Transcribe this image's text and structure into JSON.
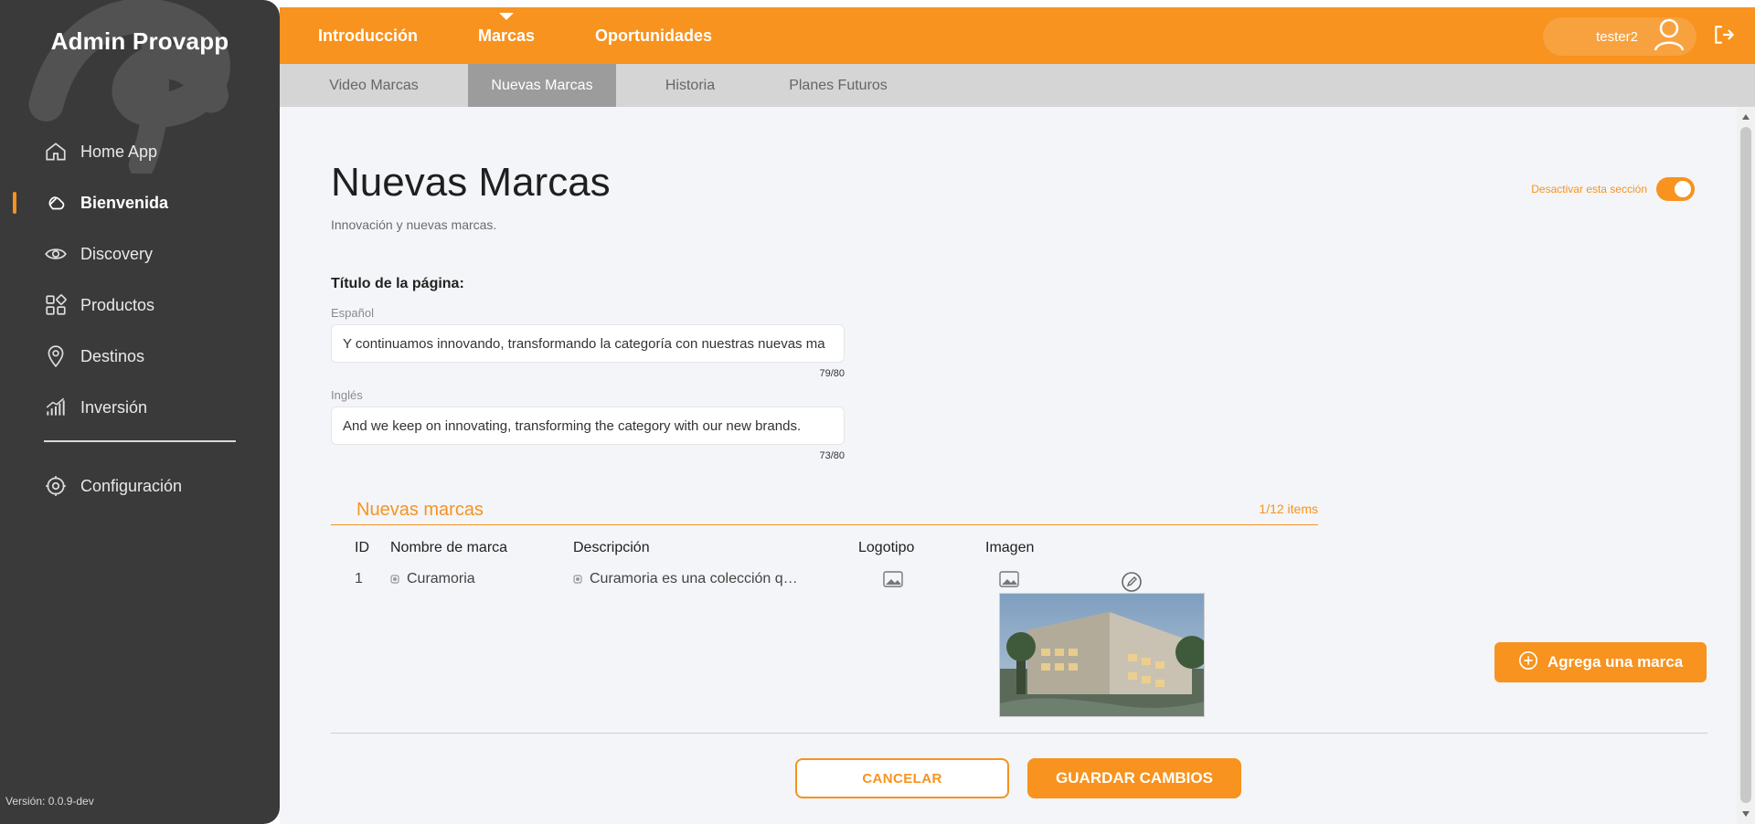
{
  "sidebar": {
    "brand": "Admin Provapp",
    "items": [
      {
        "label": "Home App",
        "icon": "home-icon"
      },
      {
        "label": "Bienvenida",
        "icon": "wave-hand-icon"
      },
      {
        "label": "Discovery",
        "icon": "eye-icon"
      },
      {
        "label": "Productos",
        "icon": "grid-apps-icon"
      },
      {
        "label": "Destinos",
        "icon": "location-pin-icon"
      },
      {
        "label": "Inversión",
        "icon": "investment-chart-icon"
      }
    ],
    "active_index": 1,
    "config": {
      "label": "Configuración",
      "icon": "gear-icon"
    },
    "version": "Versión: 0.0.9-dev"
  },
  "topbar": {
    "tabs": [
      "Introducción",
      "Marcas",
      "Oportunidades"
    ],
    "active_tab": "Marcas",
    "user_name": "tester2",
    "user_icon": "user-icon",
    "logout_icon": "logout-icon"
  },
  "subtabs": {
    "items": [
      "Video Marcas",
      "Nuevas Marcas",
      "Historia",
      "Planes Futuros"
    ],
    "active": "Nuevas Marcas"
  },
  "page": {
    "title": "Nuevas Marcas",
    "subtitle": "Innovación y nuevas marcas.",
    "toggle_label": "Desactivar esta sección",
    "toggle_on": true,
    "form": {
      "title_label": "Título de la página:",
      "spanish_label": "Español",
      "spanish_value": "Y continuamos innovando, transformando la categoría con nuestras nuevas ma",
      "spanish_counter": "79/80",
      "english_label": "Inglés",
      "english_value": "And we keep on innovating, transforming the category with our new brands.",
      "english_counter": "73/80"
    },
    "brands": {
      "section_title": "Nuevas marcas",
      "count_text": "1/12 items",
      "headers": [
        "ID",
        "Nombre de marca",
        "Descripción",
        "Logotipo",
        "Imagen"
      ],
      "rows": [
        {
          "id": "1",
          "name": "Curamoria",
          "description": "Curamoria es una colección q…"
        }
      ]
    },
    "buttons": {
      "add_brand": "Agrega una marca",
      "cancel": "CANCELAR",
      "save": "GUARDAR CAMBIOS"
    }
  },
  "colors": {
    "accent": "#f7931e",
    "sidebar_bg": "#3a3a3a",
    "content_bg": "#f3f5f8"
  }
}
